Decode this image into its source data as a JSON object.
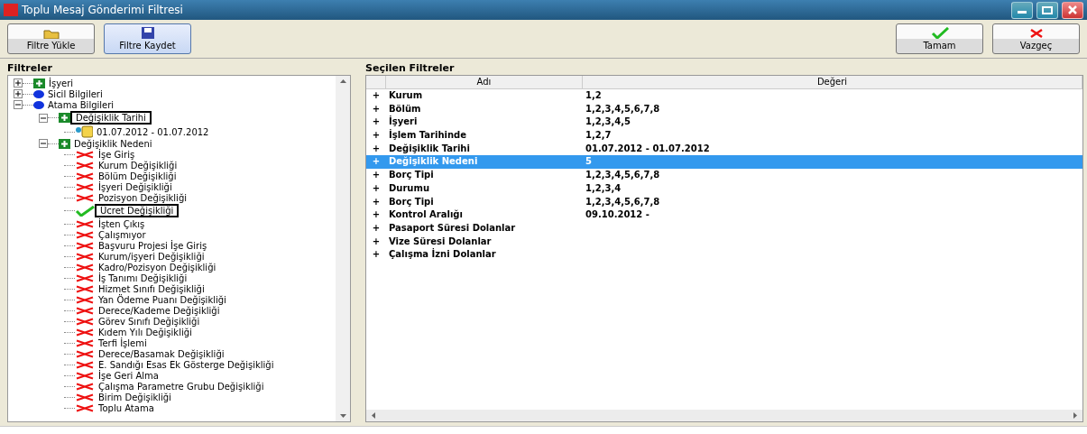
{
  "window": {
    "title": "Toplu Mesaj Gönderimi Filtresi"
  },
  "toolbar": {
    "left": [
      {
        "label": "Filtre Yükle",
        "kind": "open",
        "selected": false
      },
      {
        "label": "Filtre Kaydet",
        "kind": "save",
        "selected": true
      }
    ],
    "right": [
      {
        "label": "Tamam",
        "kind": "ok"
      },
      {
        "label": "Vazgeç",
        "kind": "cancel"
      }
    ]
  },
  "filters": {
    "title": "Filtreler",
    "tree": [
      {
        "label": "İşyeri",
        "kind": "group",
        "expanded": false,
        "highlighted": false
      },
      {
        "label": "Sicil Bilgileri",
        "kind": "category",
        "expanded": false,
        "highlighted": false
      },
      {
        "label": "Atama Bilgileri",
        "kind": "category",
        "expanded": true,
        "highlighted": false,
        "children": [
          {
            "label": "Değişiklik Tarihi",
            "kind": "group",
            "expanded": true,
            "highlighted": true,
            "children": [
              {
                "label": "01.07.2012 - 01.07.2012",
                "kind": "value",
                "highlighted": false
              }
            ]
          },
          {
            "label": "Değişiklik Nedeni",
            "kind": "group",
            "expanded": true,
            "highlighted": false,
            "children": [
              {
                "label": "İşe Giriş",
                "kind": "option",
                "checked": false,
                "highlighted": false
              },
              {
                "label": "Kurum Değişikliği",
                "kind": "option",
                "checked": false,
                "highlighted": false
              },
              {
                "label": "Bölüm Değişikliği",
                "kind": "option",
                "checked": false,
                "highlighted": false
              },
              {
                "label": "İşyeri Değişikliği",
                "kind": "option",
                "checked": false,
                "highlighted": false
              },
              {
                "label": "Pozisyon Değişikliği",
                "kind": "option",
                "checked": false,
                "highlighted": false
              },
              {
                "label": "Ücret Değişikliği",
                "kind": "option",
                "checked": true,
                "highlighted": true
              },
              {
                "label": "İşten Çıkış",
                "kind": "option",
                "checked": false,
                "highlighted": false
              },
              {
                "label": "Çalışmıyor",
                "kind": "option",
                "checked": false,
                "highlighted": false
              },
              {
                "label": "Başvuru Projesi İşe Giriş",
                "kind": "option",
                "checked": false,
                "highlighted": false
              },
              {
                "label": "Kurum/işyeri Değişikliği",
                "kind": "option",
                "checked": false,
                "highlighted": false
              },
              {
                "label": "Kadro/Pozisyon Değişikliği",
                "kind": "option",
                "checked": false,
                "highlighted": false
              },
              {
                "label": "İş Tanımı Değişikliği",
                "kind": "option",
                "checked": false,
                "highlighted": false
              },
              {
                "label": "Hizmet Sınıfı Değişikliği",
                "kind": "option",
                "checked": false,
                "highlighted": false
              },
              {
                "label": "Yan Ödeme Puanı Değişikliği",
                "kind": "option",
                "checked": false,
                "highlighted": false
              },
              {
                "label": "Derece/Kademe Değişikliği",
                "kind": "option",
                "checked": false,
                "highlighted": false
              },
              {
                "label": "Görev Sınıfı Değişikliği",
                "kind": "option",
                "checked": false,
                "highlighted": false
              },
              {
                "label": "Kıdem Yılı Değişikliği",
                "kind": "option",
                "checked": false,
                "highlighted": false
              },
              {
                "label": "Terfi İşlemi",
                "kind": "option",
                "checked": false,
                "highlighted": false
              },
              {
                "label": "Derece/Basamak Değişikliği",
                "kind": "option",
                "checked": false,
                "highlighted": false
              },
              {
                "label": "E. Sandığı Esas Ek Gösterge Değişikliği",
                "kind": "option",
                "checked": false,
                "highlighted": false
              },
              {
                "label": "İşe Geri Alma",
                "kind": "option",
                "checked": false,
                "highlighted": false
              },
              {
                "label": "Çalışma Parametre Grubu Değişikliği",
                "kind": "option",
                "checked": false,
                "highlighted": false
              },
              {
                "label": "Birim Değişikliği",
                "kind": "option",
                "checked": false,
                "highlighted": false
              },
              {
                "label": "Toplu Atama",
                "kind": "option",
                "checked": false,
                "highlighted": false
              }
            ]
          }
        ]
      }
    ]
  },
  "selected_filters": {
    "title": "Seçilen Filtreler",
    "columns": [
      "Adı",
      "Değeri"
    ],
    "rows": [
      {
        "expander": "+",
        "name": "Kurum",
        "value": "1,2",
        "selected": false
      },
      {
        "expander": "+",
        "name": "Bölüm",
        "value": "1,2,3,4,5,6,7,8",
        "selected": false
      },
      {
        "expander": "+",
        "name": "İşyeri",
        "value": "1,2,3,4,5",
        "selected": false
      },
      {
        "expander": "+",
        "name": "İşlem Tarihinde",
        "value": "1,2,7",
        "selected": false
      },
      {
        "expander": "+",
        "name": "Değişiklik Tarihi",
        "value": "01.07.2012 - 01.07.2012",
        "selected": false
      },
      {
        "expander": "+",
        "name": "Değişiklik Nedeni",
        "value": "5",
        "selected": true
      },
      {
        "expander": "+",
        "name": "Borç Tipi",
        "value": "1,2,3,4,5,6,7,8",
        "selected": false
      },
      {
        "expander": "+",
        "name": "Durumu",
        "value": "1,2,3,4",
        "selected": false
      },
      {
        "expander": "+",
        "name": "Borç Tipi",
        "value": "1,2,3,4,5,6,7,8",
        "selected": false
      },
      {
        "expander": "+",
        "name": "Kontrol Aralığı",
        "value": "09.10.2012 -",
        "selected": false
      },
      {
        "expander": "+",
        "name": "Pasaport Süresi Dolanlar",
        "selected": false
      },
      {
        "expander": "+",
        "name": "Vize Süresi Dolanlar",
        "selected": false
      },
      {
        "expander": "+",
        "name": "Çalışma İzni Dolanlar",
        "selected": false
      }
    ]
  }
}
